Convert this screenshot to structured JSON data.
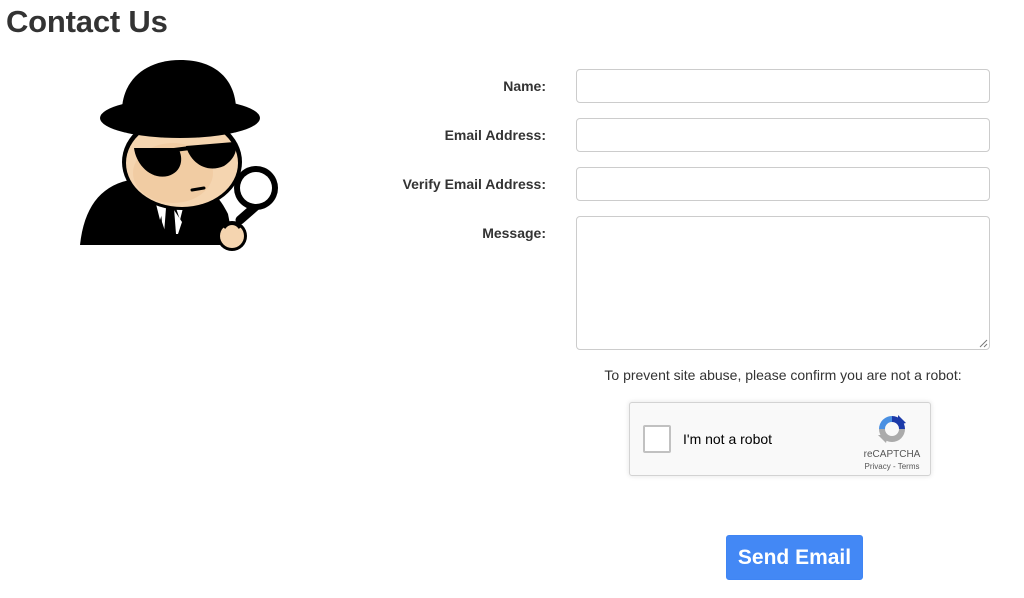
{
  "page": {
    "title": "Contact Us"
  },
  "form": {
    "name_label": "Name:",
    "email_label": "Email Address:",
    "verify_email_label": "Verify Email Address:",
    "message_label": "Message:",
    "name_value": "",
    "email_value": "",
    "verify_email_value": "",
    "message_value": ""
  },
  "captcha": {
    "note": "To prevent site abuse, please confirm you are not a robot:",
    "checkbox_label": "I'm not a robot",
    "brand": "reCAPTCHA",
    "privacy_link": "Privacy",
    "separator": " - ",
    "terms_link": "Terms",
    "icon": "recaptcha-logo-icon"
  },
  "actions": {
    "send_label": "Send Email"
  },
  "colors": {
    "primary_button": "#4388f5",
    "text": "#333333",
    "recaptcha_blue": "#1c3aa9",
    "recaptcha_light_blue": "#4a90e2",
    "recaptcha_gray": "#ababab"
  },
  "illustration": {
    "icon": "detective-spy-icon"
  }
}
